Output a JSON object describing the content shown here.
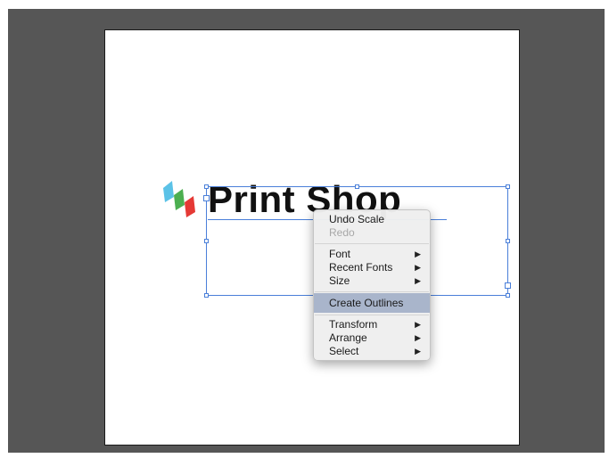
{
  "canvas": {
    "logo_text": "Print Shop",
    "logo_colors": [
      "#5bc2e7",
      "#4caf50",
      "#e53935"
    ]
  },
  "context_menu": {
    "undo": "Undo Scale",
    "redo": "Redo",
    "font": "Font",
    "recent_fonts": "Recent Fonts",
    "size": "Size",
    "create_outlines": "Create Outlines",
    "transform": "Transform",
    "arrange": "Arrange",
    "select": "Select",
    "submenu_arrow": "▶"
  },
  "colors": {
    "workspace": "#565656",
    "selection": "#4a7fd9",
    "menu_highlight": "#a9b5cb"
  }
}
